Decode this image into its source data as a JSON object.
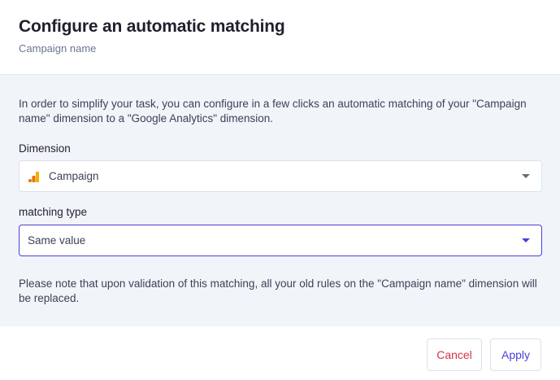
{
  "dialog": {
    "title": "Configure an automatic matching",
    "subtitle": "Campaign name"
  },
  "intro_text": "In order to simplify your task, you can configure in a few clicks an automatic matching of your \"Campaign name\" dimension to a \"Google Analytics\" dimension.",
  "dimension": {
    "label": "Dimension",
    "value": "Campaign",
    "icon": "google-analytics-icon"
  },
  "matching_type": {
    "label": "matching type",
    "value": "Same value"
  },
  "note_text": "Please note that upon validation of this matching, all your old rules on the \"Campaign name\" dimension will be replaced.",
  "buttons": {
    "cancel": "Cancel",
    "apply": "Apply"
  },
  "colors": {
    "accent": "#4b3fd6",
    "danger": "#d2344a",
    "body_bg": "#f1f4f9",
    "ga_orange": "#f9ab00",
    "ga_dark_orange": "#e37400"
  }
}
